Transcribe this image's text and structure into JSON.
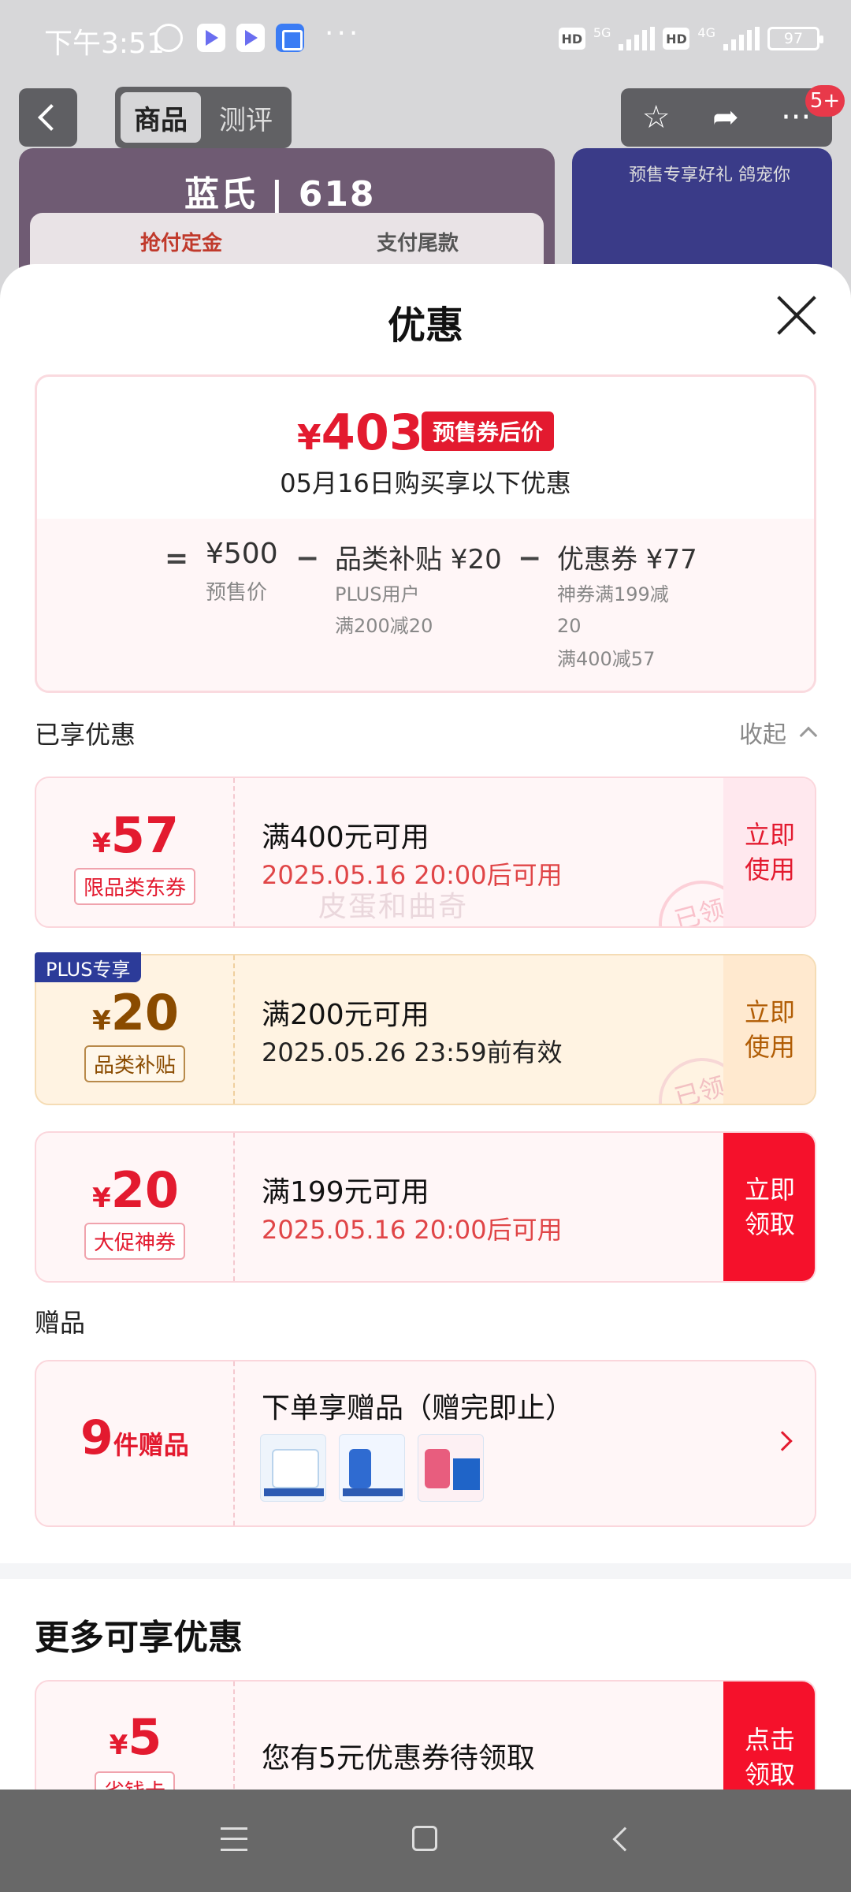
{
  "status_bar": {
    "time": "下午3:51",
    "network_1": "5G",
    "network_2": "4G",
    "hd": "HD",
    "battery": "97"
  },
  "background_page": {
    "tabs": [
      "商品",
      "测评"
    ],
    "brand": "蓝氏 | 618",
    "banner_tab_left": "抢付定金",
    "banner_tab_right": "支付尾款",
    "promo_right": "预售专享好礼 鸽宠你",
    "badge": "5+"
  },
  "sheet": {
    "title": "优惠",
    "summary": {
      "currency": "¥",
      "price": "403",
      "price_tag": "预售券后价",
      "subtitle": "05月16日购买享以下优惠",
      "eq": "=",
      "minus": "−",
      "presale_price": "¥500",
      "presale_label": "预售价",
      "subsidy": "品类补贴 ¥20",
      "subsidy_sub1": "PLUS用户",
      "subsidy_sub2": "满200减20",
      "coupon": "优惠券 ¥77",
      "coupon_sub1": "神券满199减",
      "coupon_sub2": "20",
      "coupon_sub3": "满400减57"
    },
    "enjoyed_label": "已享优惠",
    "collapse_label": "收起",
    "watermark": "皮蛋和曲奇",
    "stamp_text": "已领",
    "coupons": [
      {
        "yen": "¥",
        "amount": "57",
        "type": "限品类东券",
        "title": "满400元可用",
        "desc": "2025.05.16 20:00后可用",
        "action": "立即使用"
      },
      {
        "plus_tag": "PLUS专享",
        "yen": "¥",
        "amount": "20",
        "type": "品类补贴",
        "title": "满200元可用",
        "desc": "2025.05.26 23:59前有效",
        "action": "立即使用"
      },
      {
        "yen": "¥",
        "amount": "20",
        "type": "大促神券",
        "title": "满199元可用",
        "desc": "2025.05.16 20:00后可用",
        "action": "立即领取"
      }
    ],
    "gift_section_label": "赠品",
    "gift": {
      "count": "9",
      "count_label": "件赠品",
      "title": "下单享赠品（赠完即止）"
    },
    "more_title": "更多可享优惠",
    "more_coupon": {
      "yen": "¥",
      "amount": "5",
      "type": "省钱卡",
      "title": "您有5元优惠券待领取",
      "action": "点击领取"
    }
  },
  "colors": {
    "accent_red": "#e31a2f",
    "plus_blue": "#2c3b99",
    "gold_text": "#8a4b00"
  }
}
